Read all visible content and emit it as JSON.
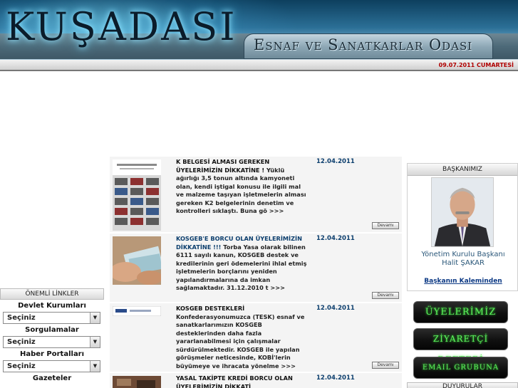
{
  "header": {
    "logo": "KUŞADASI",
    "subtitle": "Esnaf ve Sanatkarlar Odası",
    "date": "09.07.2011 CUMARTESİ"
  },
  "links": {
    "title": "ÖNEMLİ LİNKLER",
    "groups": [
      {
        "label": "Devlet Kurumları",
        "selected": "Seçiniz"
      },
      {
        "label": "Sorgulamalar",
        "selected": "Seçiniz"
      },
      {
        "label": "Haber Portalları",
        "selected": "Seçiniz"
      },
      {
        "label": "Gazeteler"
      }
    ]
  },
  "news": [
    {
      "title": "K BELGESİ ALMASI GEREKEN ÜYELERİMİZİN DİKKATİNE !",
      "body": "Yüklü ağırlığı 3,5 tonun altında kamyoneti olan, kendi iştigal konusu ile ilgili mal ve malzeme taşıyan işletmelerin alması gereken K2 belgelerinin denetim ve kontrolleri sıklaştı. Buna gö >>>",
      "date": "12.04.2011",
      "more": "Devamı"
    },
    {
      "title": "KOSGEB'E BORCU OLAN ÜYELERİMİZİN DİKKATİNE !!!",
      "body": "Torba Yasa olarak bilinen 6111 sayılı kanun, KOSGEB destek ve kredilerinin geri ödemelerini ihlal etmiş işletmelerin borçlarını yeniden yapılandırmalarına da imkan sağlamaktadır. 31.12.2010 t >>>",
      "date": "12.04.2011",
      "more": "Devamı"
    },
    {
      "title": "KOSGEB DESTEKLERİ",
      "body": "Konfederasyonumuzca (TESK) esnaf ve sanatkarlarımızın KOSGEB desteklerinden daha fazla yararlanabilmesi için çalışmalar sürdürülmektedir. KOSGEB ile yapılan görüşmeler neticesinde, KOBİ'lerin büyümeye ve ihracata yönelme >>>",
      "date": "12.04.2011",
      "more": "Devamı"
    },
    {
      "title": "YASAL TAKİPTE KREDİ BORCU OLAN ÜYELERİMİZİN DİKKATİ",
      "body": "",
      "date": "12.04.2011"
    }
  ],
  "president": {
    "title": "BAŞKANIMIZ",
    "role": "Yönetim Kurulu Başkanı",
    "name": "Halit ŞAKAR",
    "link": "Başkanın Kaleminden"
  },
  "buttons": {
    "members": "ÜYELERİMİZ",
    "guestbook": "ZİYARETÇİ DEFTERİ",
    "email": "EMAIL GRUBUNA KATIL"
  },
  "announcements": {
    "title": "DUYURULAR"
  }
}
